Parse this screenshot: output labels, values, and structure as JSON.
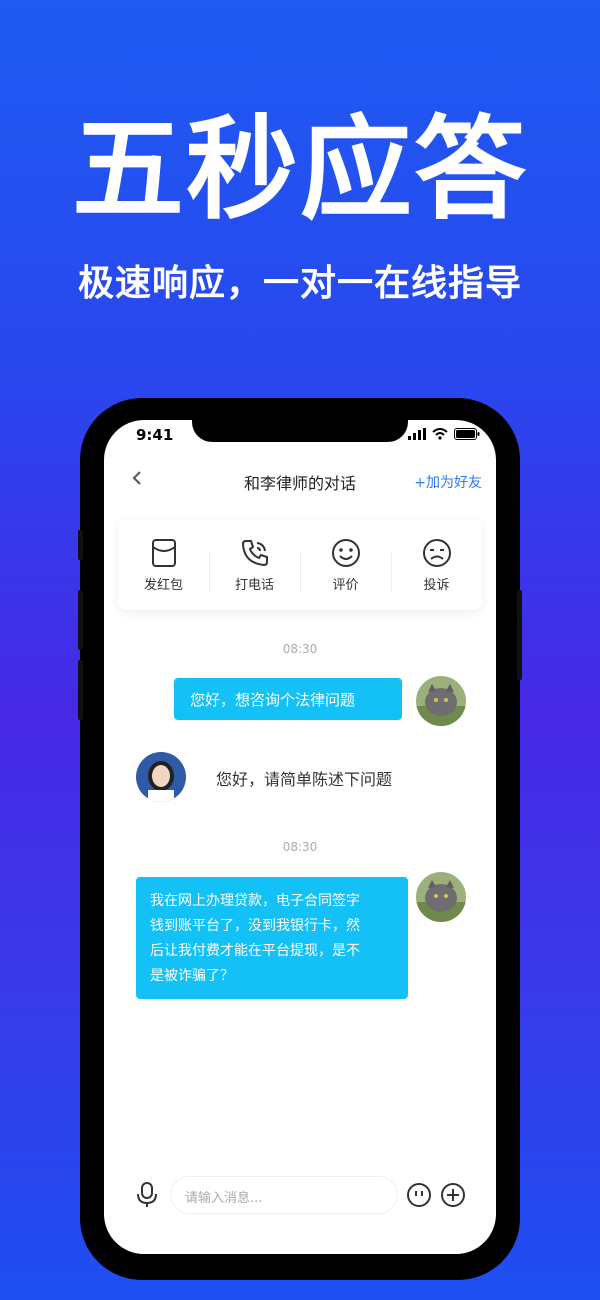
{
  "promo": {
    "headline": "五秒应答",
    "subline": "极速响应，一对一在线指导"
  },
  "status_bar": {
    "time": "9:41"
  },
  "nav": {
    "back_icon": "chevron-left-icon",
    "title": "和李律师的对话",
    "add_friend": "+加为好友"
  },
  "actions": [
    {
      "label": "发红包",
      "icon": "red-packet-icon"
    },
    {
      "label": "打电话",
      "icon": "phone-icon"
    },
    {
      "label": "评价",
      "icon": "smile-icon"
    },
    {
      "label": "投诉",
      "icon": "frown-icon"
    }
  ],
  "messages": {
    "time1": "08:30",
    "msg1": "您好，想咨询个法律问题",
    "msg2": "您好，请简单陈述下问题",
    "time2": "08:30",
    "msg3_lines": [
      "我在网上办理贷款，电子合同签字",
      "钱到账平台了，没到我银行卡，然",
      "后让我付费才能在平台提现，是不",
      "是被诈骗了？"
    ]
  },
  "input": {
    "placeholder": "请输入消息..."
  },
  "colors": {
    "accent": "#2b7cf7",
    "bubble": "#14c1f7"
  }
}
